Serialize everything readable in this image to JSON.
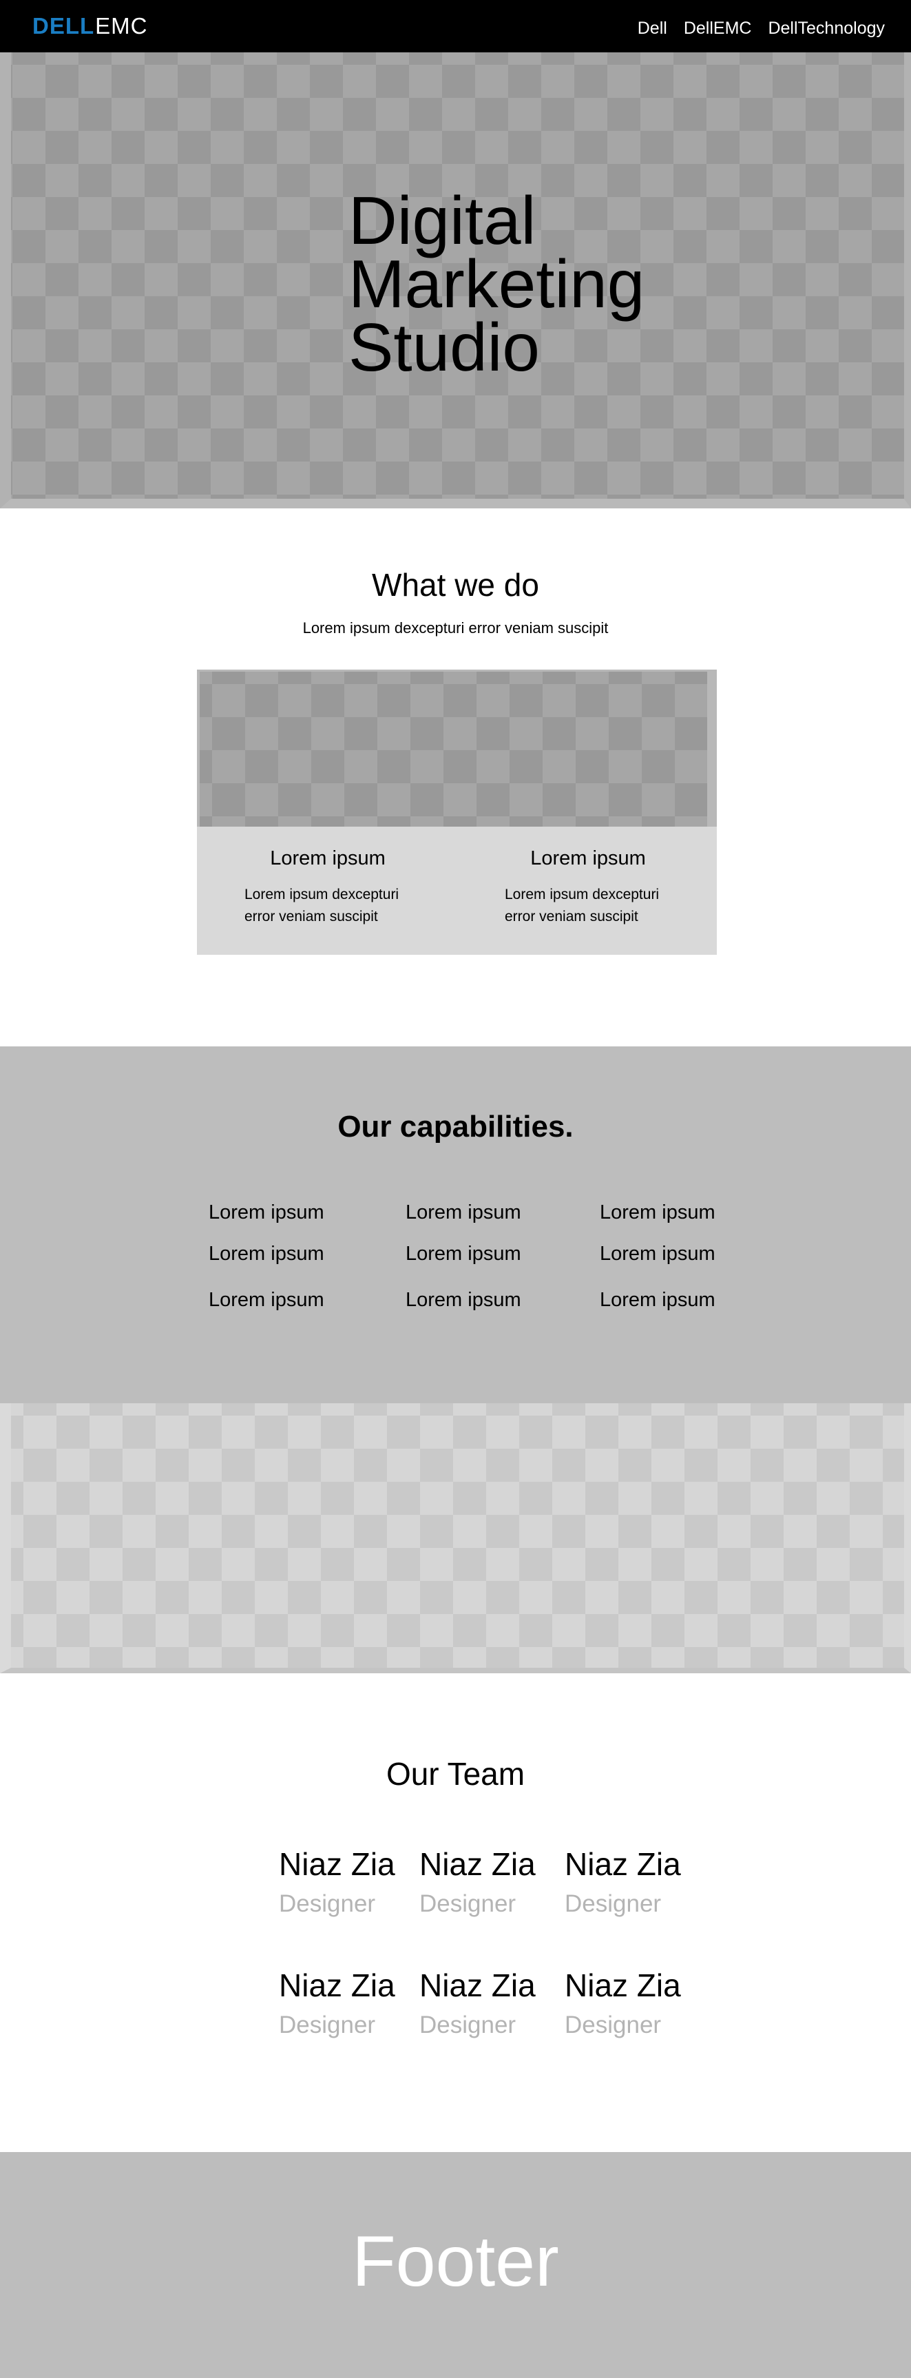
{
  "header": {
    "logo_dell": "DELL",
    "logo_emc": "EMC",
    "nav": [
      "Dell",
      "DellEMC",
      "DellTechnology"
    ]
  },
  "hero": {
    "title_lines": [
      "Digital",
      "Marketing",
      "Studio"
    ]
  },
  "what_we_do": {
    "title": "What we do",
    "subtitle": "Lorem ipsum dexcepturi error veniam suscipit",
    "columns": [
      {
        "heading": "Lorem ipsum",
        "text_lines": [
          "Lorem ipsum dexcepturi",
          "error veniam suscipit"
        ]
      },
      {
        "heading": "Lorem ipsum",
        "text_lines": [
          "Lorem ipsum dexcepturi",
          "error veniam suscipit"
        ]
      }
    ]
  },
  "capabilities": {
    "title": "Our capabilities.",
    "items": [
      "Lorem ipsum",
      "Lorem ipsum",
      "Lorem ipsum",
      "Lorem ipsum",
      "Lorem ipsum",
      "Lorem ipsum",
      "Lorem ipsum",
      "Lorem ipsum",
      "Lorem ipsum"
    ]
  },
  "team": {
    "title": "Our Team",
    "members": [
      {
        "name": "Niaz Zia",
        "role": "Designer"
      },
      {
        "name": "Niaz Zia",
        "role": "Designer"
      },
      {
        "name": "Niaz Zia",
        "role": "Designer"
      },
      {
        "name": "Niaz Zia",
        "role": "Designer"
      },
      {
        "name": "Niaz Zia",
        "role": "Designer"
      },
      {
        "name": "Niaz Zia",
        "role": "Designer"
      }
    ]
  },
  "footer": {
    "text": "Footer"
  },
  "colors": {
    "header_bg": "#000000",
    "brand_blue": "#1a7ec4",
    "section_gray": "#bdbdbd",
    "card_gray": "#d9d9d9",
    "role_gray": "#b4b4b4"
  }
}
